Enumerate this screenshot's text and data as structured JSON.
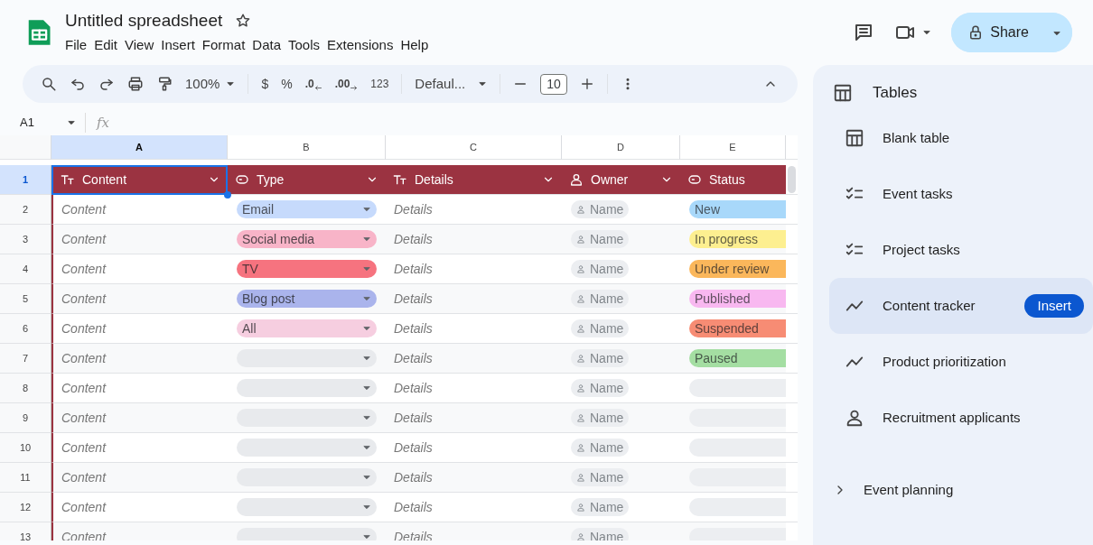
{
  "title": "Untitled spreadsheet",
  "menu": [
    "File",
    "Edit",
    "View",
    "Insert",
    "Format",
    "Data",
    "Tools",
    "Extensions",
    "Help"
  ],
  "share": {
    "label": "Share"
  },
  "toolbar": {
    "zoom": "100%",
    "currency": "$",
    "percent": "%",
    "decrease_decimal": ".0",
    "increase_decimal": ".00",
    "number_format": "123",
    "font": "Defaul...",
    "font_size": "10"
  },
  "name_box": "A1",
  "formula_label": "fx",
  "columns": [
    {
      "label": "A",
      "selected": true
    },
    {
      "label": "B",
      "selected": false
    },
    {
      "label": "C",
      "selected": false
    },
    {
      "label": "D",
      "selected": false
    },
    {
      "label": "E",
      "selected": false
    }
  ],
  "header_row": {
    "number": "1",
    "selected": true,
    "cells": [
      {
        "label": "Content",
        "kind": "text"
      },
      {
        "label": "Type",
        "kind": "dropdown"
      },
      {
        "label": "Details",
        "kind": "text"
      },
      {
        "label": "Owner",
        "kind": "person"
      },
      {
        "label": "Status",
        "kind": "dropdown"
      }
    ]
  },
  "rows": [
    {
      "number": "2",
      "content": "Content",
      "type": {
        "label": "Email",
        "color": "#c6dafc"
      },
      "details": "Details",
      "owner": "Name",
      "status": {
        "label": "New",
        "color": "#a8d8fa"
      }
    },
    {
      "number": "3",
      "content": "Content",
      "type": {
        "label": "Social media",
        "color": "#f8b4c8"
      },
      "details": "Details",
      "owner": "Name",
      "status": {
        "label": "In progress",
        "color": "#fdef90"
      }
    },
    {
      "number": "4",
      "content": "Content",
      "type": {
        "label": "TV",
        "color": "#f6737f"
      },
      "details": "Details",
      "owner": "Name",
      "status": {
        "label": "Under review",
        "color": "#fbb75b"
      }
    },
    {
      "number": "5",
      "content": "Content",
      "type": {
        "label": "Blog post",
        "color": "#aab4ec"
      },
      "details": "Details",
      "owner": "Name",
      "status": {
        "label": "Published",
        "color": "#f8b8f0"
      }
    },
    {
      "number": "6",
      "content": "Content",
      "type": {
        "label": "All",
        "color": "#f6cee0"
      },
      "details": "Details",
      "owner": "Name",
      "status": {
        "label": "Suspended",
        "color": "#f78c74"
      }
    },
    {
      "number": "7",
      "content": "Content",
      "details": "Details",
      "owner": "Name",
      "status": {
        "label": "Paused",
        "color": "#a4dea2"
      }
    },
    {
      "number": "8",
      "content": "Content",
      "details": "Details",
      "owner": "Name"
    },
    {
      "number": "9",
      "content": "Content",
      "details": "Details",
      "owner": "Name"
    },
    {
      "number": "10",
      "content": "Content",
      "details": "Details",
      "owner": "Name"
    },
    {
      "number": "11",
      "content": "Content",
      "details": "Details",
      "owner": "Name"
    },
    {
      "number": "12",
      "content": "Content",
      "details": "Details",
      "owner": "Name"
    },
    {
      "number": "13",
      "content": "Content",
      "details": "Details",
      "owner": "Name"
    }
  ],
  "sidebar": {
    "title": "Tables",
    "items": [
      {
        "label": "Blank table",
        "kind": "table",
        "selected": false
      },
      {
        "label": "Event tasks",
        "kind": "checklist",
        "selected": false
      },
      {
        "label": "Project tasks",
        "kind": "checklist",
        "selected": false
      },
      {
        "label": "Content tracker",
        "kind": "trend",
        "selected": true
      },
      {
        "label": "Product prioritization",
        "kind": "trend",
        "selected": false
      },
      {
        "label": "Recruitment applicants",
        "kind": "person",
        "selected": false
      }
    ],
    "action": "Insert",
    "sections": [
      {
        "label": "Event planning",
        "expanded": false
      }
    ]
  }
}
